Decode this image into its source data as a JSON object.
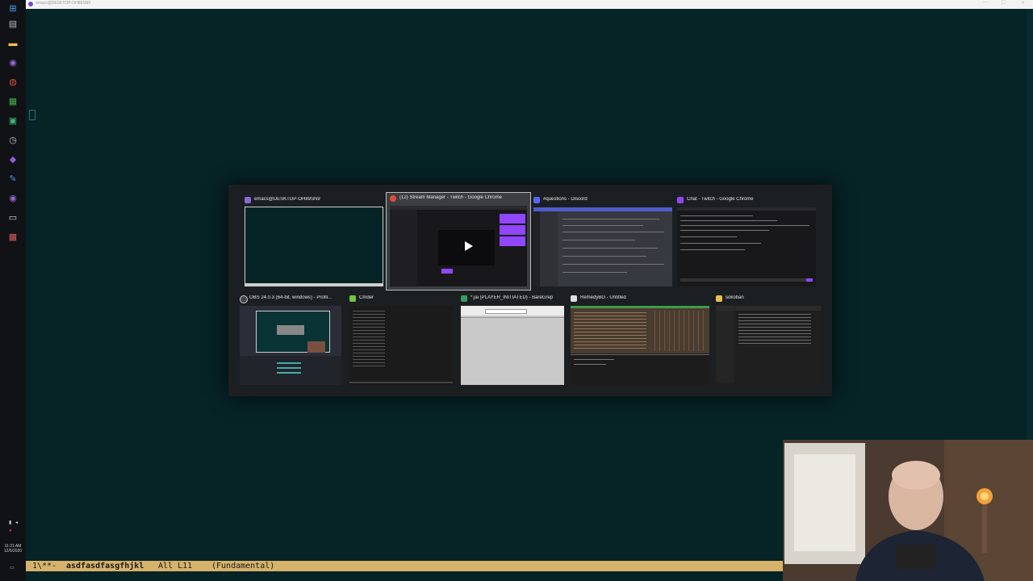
{
  "window": {
    "title": "emacs@DESKTOP-OH89SN9"
  },
  "taskbar": {
    "icons": [
      {
        "name": "windows-start-icon",
        "glyph": "⊞",
        "color": "#4aa3ff"
      },
      {
        "name": "task-view-icon",
        "glyph": "▤",
        "color": "#bbbbbb"
      },
      {
        "name": "file-explorer-icon",
        "glyph": "▬",
        "color": "#e8c14a"
      },
      {
        "name": "emacs-icon",
        "glyph": "◉",
        "color": "#8a6bd1"
      },
      {
        "name": "chrome-icon",
        "glyph": "◍",
        "color": "#e04b3a"
      },
      {
        "name": "app-green-icon",
        "glyph": "▦",
        "color": "#49b04a"
      },
      {
        "name": "bluetooth-app-icon",
        "glyph": "▣",
        "color": "#43b37a"
      },
      {
        "name": "clock-app-icon",
        "glyph": "◷",
        "color": "#cccccc"
      },
      {
        "name": "visual-studio-icon",
        "glyph": "◆",
        "color": "#8f5bd6"
      },
      {
        "name": "pen-tool-icon",
        "glyph": "✎",
        "color": "#5a8fe6"
      },
      {
        "name": "emacs-2-icon",
        "glyph": "◉",
        "color": "#8a6bd1"
      },
      {
        "name": "terminal-app-icon",
        "glyph": "▭",
        "color": "#dddddd"
      },
      {
        "name": "remedybg-icon",
        "glyph": "▩",
        "color": "#d65b5b"
      }
    ],
    "clock_time": "11:21 AM",
    "clock_date": "12/5/2020"
  },
  "switcher": {
    "row1": [
      {
        "label": "emacs@DESKTOP-OH89SN9",
        "icon": "emacs-icon",
        "icon_color": "#8a6bd1",
        "selected": false
      },
      {
        "label": "(12) Stream Manager - Twitch - Google Chrome",
        "icon": "chrome-icon",
        "icon_color": "#e04b3a",
        "selected": true
      },
      {
        "label": "#questions - Discord",
        "icon": "discord-icon",
        "icon_color": "#5865f2",
        "selected": false
      },
      {
        "label": "Chat - Twitch - Google Chrome",
        "icon": "twitch-icon",
        "icon_color": "#9146ff",
        "selected": false
      }
    ],
    "row2": [
      {
        "label": "OBS 24.0.3 (64-bit, windows) - Profil...",
        "icon": "obs-icon",
        "icon_color": "#cccccc",
        "selected": false
      },
      {
        "label": "Cmder",
        "icon": "cmder-icon",
        "icon_color": "#7ac142",
        "selected": false
      },
      {
        "label": "*.jai (PLAYER_INITIATED) - BareGrep",
        "icon": "baregrep-icon",
        "icon_color": "#3c9a5f",
        "selected": false
      },
      {
        "label": "RemedyBG - Untitled",
        "icon": "remedybg-icon",
        "icon_color": "#dddddd",
        "selected": false
      },
      {
        "label": "sokoban",
        "icon": "folder-icon",
        "icon_color": "#e8c14a",
        "selected": false
      }
    ]
  },
  "modeline": {
    "status": "1\\**-",
    "buffer": "asdfasdfasgfhjkl",
    "position": "All L11",
    "mode": "(Fundamental)"
  },
  "colors": {
    "editor_bg": "#062326",
    "modeline_bg": "#d6b26b",
    "switcher_bg": "#1c1f22"
  }
}
